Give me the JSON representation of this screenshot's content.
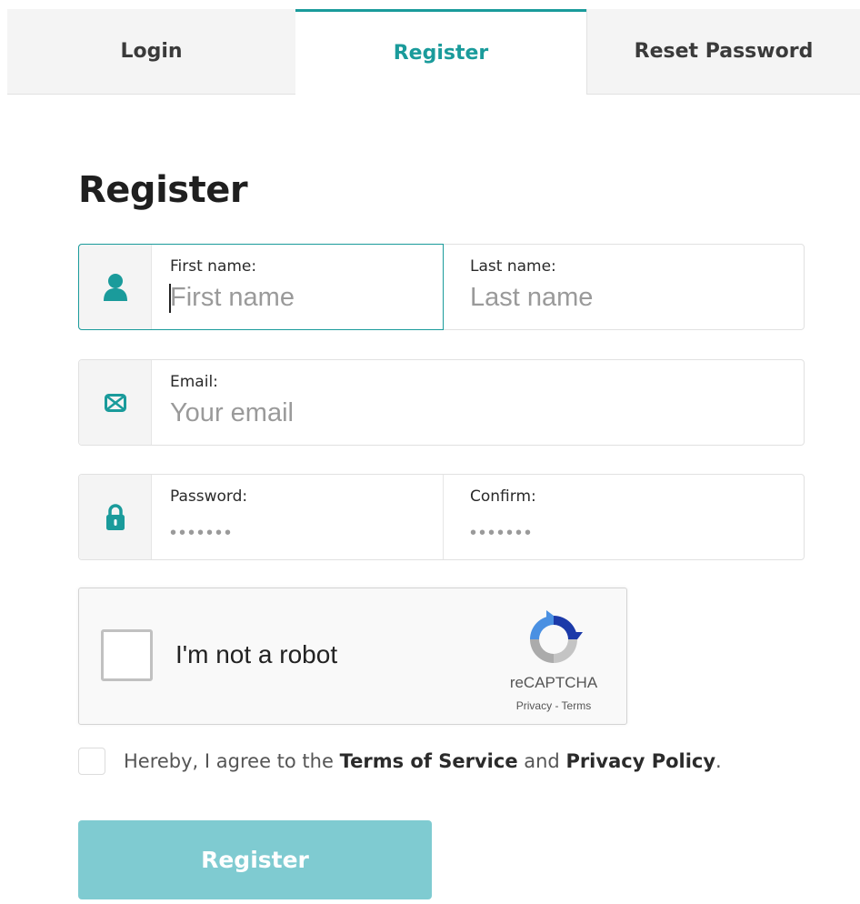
{
  "tabs": [
    {
      "label": "Login",
      "active": false
    },
    {
      "label": "Register",
      "active": true
    },
    {
      "label": "Reset Password",
      "active": false
    }
  ],
  "heading": "Register",
  "fields": {
    "first_name": {
      "label": "First name:",
      "placeholder": "First name",
      "value": ""
    },
    "last_name": {
      "label": "Last name:",
      "placeholder": "Last name",
      "value": ""
    },
    "email": {
      "label": "Email:",
      "placeholder": "Your email",
      "value": ""
    },
    "password": {
      "label": "Password:",
      "placeholder": "•••••••",
      "value": ""
    },
    "confirm": {
      "label": "Confirm:",
      "placeholder": "•••••••",
      "value": ""
    }
  },
  "icons": {
    "name": "user-icon",
    "email": "envelope-icon",
    "password": "lock-icon"
  },
  "captcha": {
    "label": "I'm not a robot",
    "brand": "reCAPTCHA",
    "links": "Privacy - Terms",
    "checked": false
  },
  "agree": {
    "prefix": "Hereby, I agree to the ",
    "terms": "Terms of Service",
    "middle": " and ",
    "privacy": "Privacy Policy",
    "suffix": ".",
    "checked": false
  },
  "submit_label": "Register",
  "colors": {
    "accent": "#1a9b9b",
    "button": "#7fcbd1"
  }
}
